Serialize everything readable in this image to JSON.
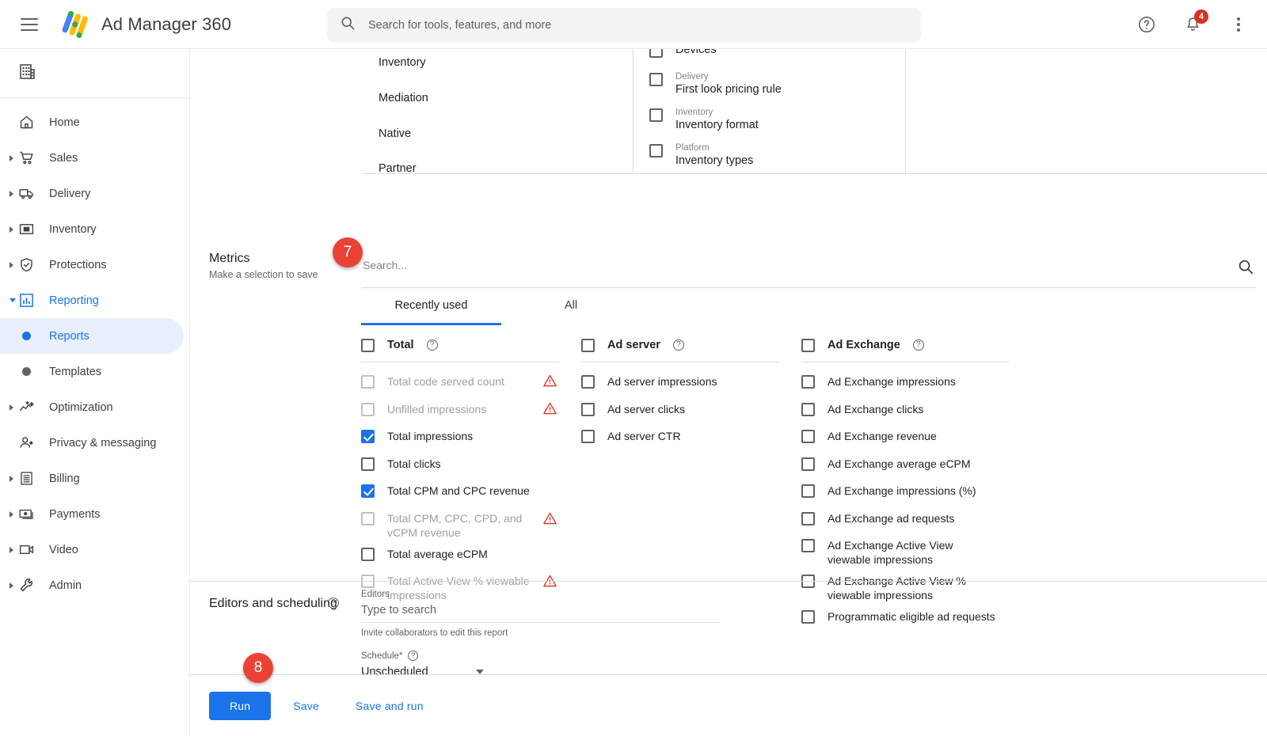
{
  "header": {
    "menu_icon": "hamburger-icon",
    "logo_icon": "ad-manager-logo",
    "title": "Ad Manager 360",
    "search_placeholder": "Search for tools, features, and more",
    "search_value": "",
    "search_icon": "search-icon",
    "help_icon": "help-circle-icon",
    "notifications_icon": "bell-icon",
    "notifications_count": "4",
    "more_icon": "more-vert-icon"
  },
  "sidebar": {
    "account_icon": "building-icon",
    "account_name": "",
    "items": [
      {
        "label": "Home",
        "icon": "home-icon",
        "expandable": false
      },
      {
        "label": "Sales",
        "icon": "cart-icon",
        "expandable": true
      },
      {
        "label": "Delivery",
        "icon": "truck-icon",
        "expandable": true
      },
      {
        "label": "Inventory",
        "icon": "inventory-icon",
        "expandable": true
      },
      {
        "label": "Protections",
        "icon": "shield-check-icon",
        "expandable": true
      },
      {
        "label": "Reporting",
        "icon": "bar-chart-icon",
        "expandable": true,
        "expanded": true,
        "active": true
      },
      {
        "label": "Optimization",
        "icon": "trending-icon",
        "expandable": true
      },
      {
        "label": "Privacy & messaging",
        "icon": "person-icon",
        "expandable": false
      },
      {
        "label": "Billing",
        "icon": "receipt-icon",
        "expandable": true
      },
      {
        "label": "Payments",
        "icon": "payments-icon",
        "expandable": true
      },
      {
        "label": "Video",
        "icon": "video-icon",
        "expandable": true
      },
      {
        "label": "Admin",
        "icon": "wrench-icon",
        "expandable": true
      }
    ],
    "sub_items": [
      {
        "label": "Reports",
        "selected": true
      },
      {
        "label": "Templates",
        "selected": false
      }
    ]
  },
  "dimensions_panel": {
    "col1_items": [
      "Inventory",
      "Mediation",
      "Native",
      "Partner"
    ],
    "col2_items": [
      {
        "category": "",
        "name": "Devices",
        "checked": false,
        "clipped": true
      },
      {
        "category": "Delivery",
        "name": "First look pricing rule",
        "checked": false
      },
      {
        "category": "Inventory",
        "name": "Inventory format",
        "checked": false
      },
      {
        "category": "Platform",
        "name": "Inventory types",
        "checked": false
      }
    ]
  },
  "metrics": {
    "title": "Metrics",
    "subtitle": "Make a selection to save",
    "search_placeholder": "Search...",
    "search_value": "",
    "search_icon": "search-icon",
    "tabs": [
      {
        "label": "Recently used",
        "selected": true
      },
      {
        "label": "All",
        "selected": false
      }
    ],
    "groups": [
      {
        "name": "Total",
        "checked": false,
        "help_icon": "help-circle-icon",
        "items": [
          {
            "label": "Total code served count",
            "checked": false,
            "disabled": true,
            "warning": true
          },
          {
            "label": "Unfilled impressions",
            "checked": false,
            "disabled": true,
            "warning": true
          },
          {
            "label": "Total impressions",
            "checked": true,
            "disabled": false,
            "warning": false
          },
          {
            "label": "Total clicks",
            "checked": false,
            "disabled": false,
            "warning": false
          },
          {
            "label": "Total CPM and CPC revenue",
            "checked": true,
            "disabled": false,
            "warning": false
          },
          {
            "label": "Total CPM, CPC, CPD, and vCPM revenue",
            "checked": false,
            "disabled": true,
            "warning": true
          },
          {
            "label": "Total average eCPM",
            "checked": false,
            "disabled": false,
            "warning": false
          },
          {
            "label": "Total Active View % viewable impressions",
            "checked": false,
            "disabled": true,
            "warning": true
          }
        ]
      },
      {
        "name": "Ad server",
        "checked": false,
        "help_icon": "help-circle-icon",
        "items": [
          {
            "label": "Ad server impressions",
            "checked": false,
            "disabled": false,
            "warning": false
          },
          {
            "label": "Ad server clicks",
            "checked": false,
            "disabled": false,
            "warning": false
          },
          {
            "label": "Ad server CTR",
            "checked": false,
            "disabled": false,
            "warning": false
          }
        ]
      },
      {
        "name": "Ad Exchange",
        "checked": false,
        "help_icon": "help-circle-icon",
        "items": [
          {
            "label": "Ad Exchange impressions",
            "checked": false,
            "disabled": false,
            "warning": false
          },
          {
            "label": "Ad Exchange clicks",
            "checked": false,
            "disabled": false,
            "warning": false
          },
          {
            "label": "Ad Exchange revenue",
            "checked": false,
            "disabled": false,
            "warning": false
          },
          {
            "label": "Ad Exchange average eCPM",
            "checked": false,
            "disabled": false,
            "warning": false
          },
          {
            "label": "Ad Exchange impressions (%)",
            "checked": false,
            "disabled": false,
            "warning": false
          },
          {
            "label": "Ad Exchange ad requests",
            "checked": false,
            "disabled": false,
            "warning": false
          },
          {
            "label": "Ad Exchange Active View viewable impressions",
            "checked": false,
            "disabled": false,
            "warning": false
          },
          {
            "label": "Ad Exchange Active View % viewable impressions",
            "checked": false,
            "disabled": false,
            "warning": false
          },
          {
            "label": "Programmatic eligible ad requests",
            "checked": false,
            "disabled": false,
            "warning": false
          }
        ]
      }
    ]
  },
  "editors": {
    "section_title": "Editors and scheduling",
    "help_icon": "help-circle-icon",
    "editors_label": "Editors",
    "editors_placeholder": "Type to search",
    "editors_value": "",
    "editors_hint": "Invite collaborators to edit this report",
    "schedule_label": "Schedule*",
    "schedule_help_icon": "help-circle-icon",
    "schedule_value": "Unscheduled",
    "dropdown_icon": "chevron-down-icon"
  },
  "footer": {
    "run_label": "Run",
    "save_label": "Save",
    "save_and_run_label": "Save and run"
  },
  "annotations": [
    {
      "number": "7"
    },
    {
      "number": "8"
    }
  ],
  "colors": {
    "accent_blue": "#1a73e8",
    "annotation_red": "#ea4335",
    "warning_red": "#d93025",
    "badge_red": "#d93025"
  }
}
